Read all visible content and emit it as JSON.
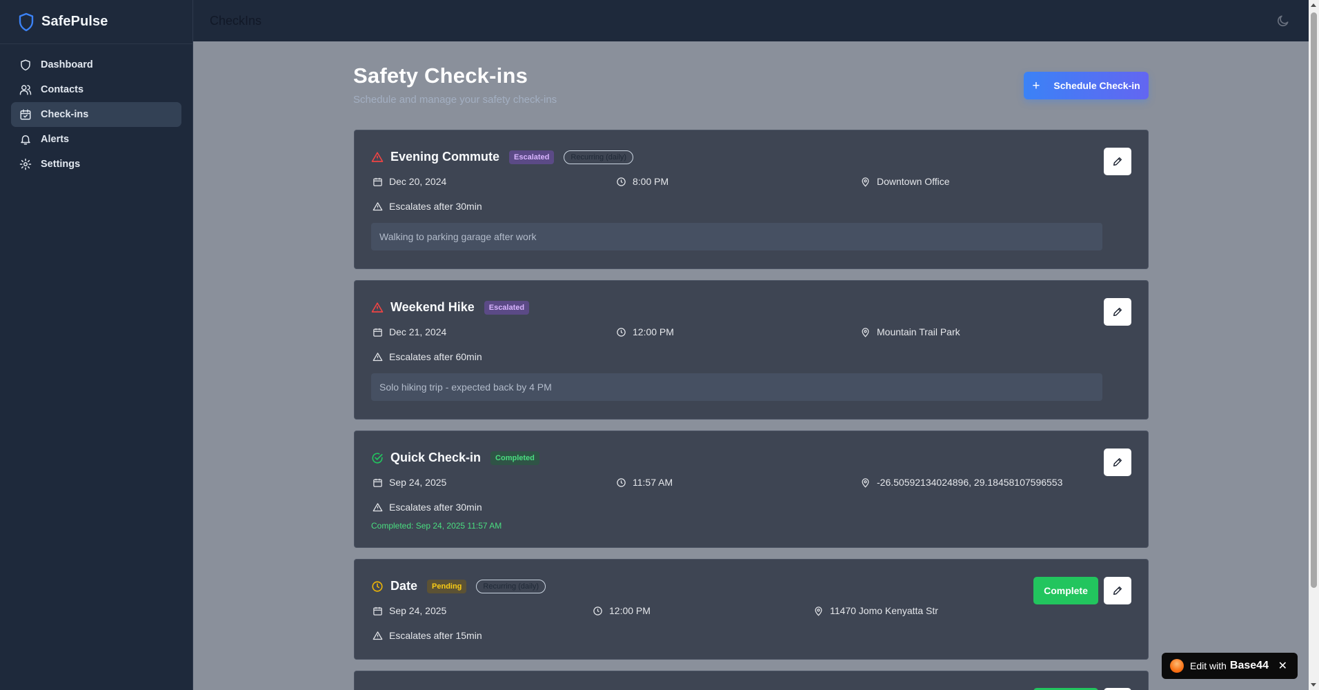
{
  "app": {
    "name": "SafePulse"
  },
  "sidebar": {
    "items": [
      {
        "label": "Dashboard",
        "icon": "shield-icon"
      },
      {
        "label": "Contacts",
        "icon": "users-icon"
      },
      {
        "label": "Check-ins",
        "icon": "calendar-check-icon",
        "active": true
      },
      {
        "label": "Alerts",
        "icon": "bell-icon"
      },
      {
        "label": "Settings",
        "icon": "gear-icon"
      }
    ]
  },
  "topbar": {
    "title": "CheckIns",
    "theme_icon": "moon-icon"
  },
  "page": {
    "title": "Safety Check-ins",
    "subtitle": "Schedule and manage your safety check-ins",
    "schedule_button": "Schedule Check-in"
  },
  "checkins": [
    {
      "title": "Evening Commute",
      "status": "Escalated",
      "recurring": "Recurring (daily)",
      "date": "Dec 20, 2024",
      "time": "8:00 PM",
      "location": "Downtown Office",
      "escalation": "Escalates after 30min",
      "note": "Walking to parking garage after work"
    },
    {
      "title": "Weekend Hike",
      "status": "Escalated",
      "date": "Dec 21, 2024",
      "time": "12:00 PM",
      "location": "Mountain Trail Park",
      "escalation": "Escalates after 60min",
      "note": "Solo hiking trip - expected back by 4 PM"
    },
    {
      "title": "Quick Check-in",
      "status": "Completed",
      "date": "Sep 24, 2025",
      "time": "11:57 AM",
      "location": "-26.50592134024896, 29.18458107596553",
      "escalation": "Escalates after 30min",
      "completed_text": "Completed: Sep 24, 2025 11:57 AM"
    },
    {
      "title": "Date",
      "status": "Pending",
      "recurring": "Recurring (daily)",
      "date": "Sep 24, 2025",
      "time": "12:00 PM",
      "location": "11470 Jomo Kenyatta Str",
      "escalation": "Escalates after 15min",
      "complete_button": "Complete"
    }
  ],
  "badge": {
    "text": "Edit with",
    "brand": "Base44",
    "close": "✕"
  },
  "colors": {
    "sidebar_bg": "#1e293b",
    "card_bg": "#3e4553",
    "accent": "#3b82f6",
    "escalated": "#ef4444",
    "completed": "#4ade80",
    "pending": "#facc15"
  }
}
